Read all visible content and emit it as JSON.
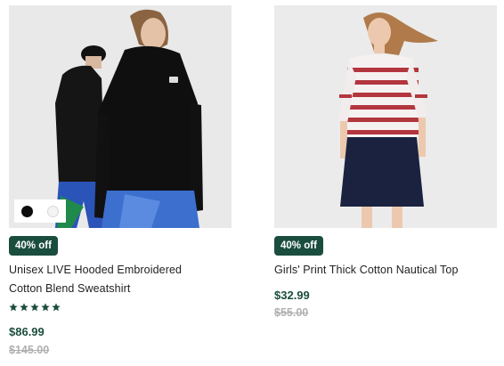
{
  "products": [
    {
      "swatches": [
        "black",
        "white"
      ],
      "badge": "40% off",
      "name_line1": "Unisex LIVE Hooded Embroidered",
      "name_line2": "Cotton Blend Sweatshirt",
      "rating": 5,
      "price": "$86.99",
      "was_price": "$145.00"
    },
    {
      "badge": "40% off",
      "name_line1": "Girls' Print Thick Cotton Nautical Top",
      "price": "$32.99",
      "was_price": "$55.00"
    }
  ],
  "colors": {
    "accent": "#1b4d3e",
    "strike": "#b0b0b0"
  }
}
